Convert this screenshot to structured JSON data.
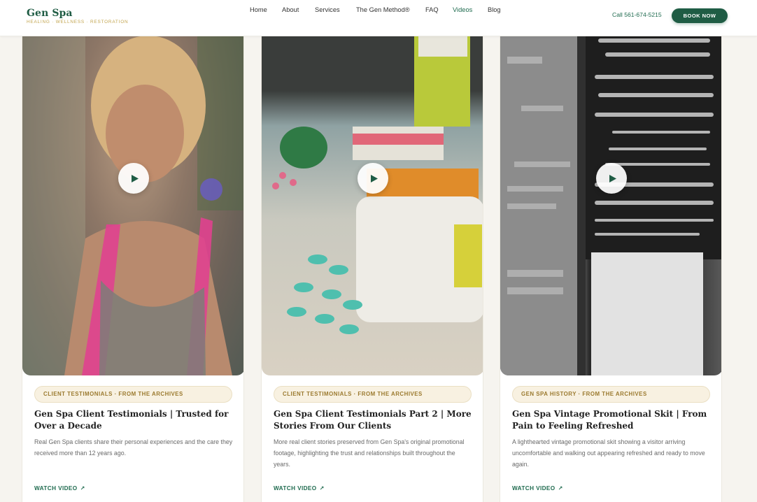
{
  "brand": {
    "name": "Gen Spa",
    "tagline": "HEALING · WELLNESS · RESTORATION",
    "accent": "#1f5c44",
    "gold": "#c2a44d"
  },
  "nav": {
    "items": [
      "Home",
      "About",
      "Services",
      "The Gen Method®",
      "FAQ",
      "Videos",
      "Blog"
    ],
    "active": "Videos"
  },
  "header": {
    "call_label": "Call 561-674-5215",
    "book_label": "BOOK NOW"
  },
  "cards": [
    {
      "category": "CLIENT TESTIMONIALS · FROM THE ARCHIVES",
      "title": "Gen Spa Client Testimonials | Trusted for Over a Decade",
      "description": "Real Gen Spa clients share their personal experiences and the care they received more than 12 years ago.",
      "cta": "WATCH VIDEO",
      "play_icon": "play-icon"
    },
    {
      "category": "CLIENT TESTIMONIALS · FROM THE ARCHIVES",
      "title": "Gen Spa Client Testimonials Part 2 | More Stories From Our Clients",
      "description": "More real client stories preserved from Gen Spa's original promotional footage, highlighting the trust and relationships built throughout the years.",
      "cta": "WATCH VIDEO",
      "play_icon": "play-icon"
    },
    {
      "category": "GEN SPA HISTORY · FROM THE ARCHIVES",
      "title": "Gen Spa Vintage Promotional Skit | From Pain to Feeling Refreshed",
      "description": "A lighthearted vintage promotional skit showing a visitor arriving uncomfortable and walking out appearing refreshed and ready to move again.",
      "cta": "WATCH VIDEO",
      "play_icon": "play-icon"
    }
  ]
}
